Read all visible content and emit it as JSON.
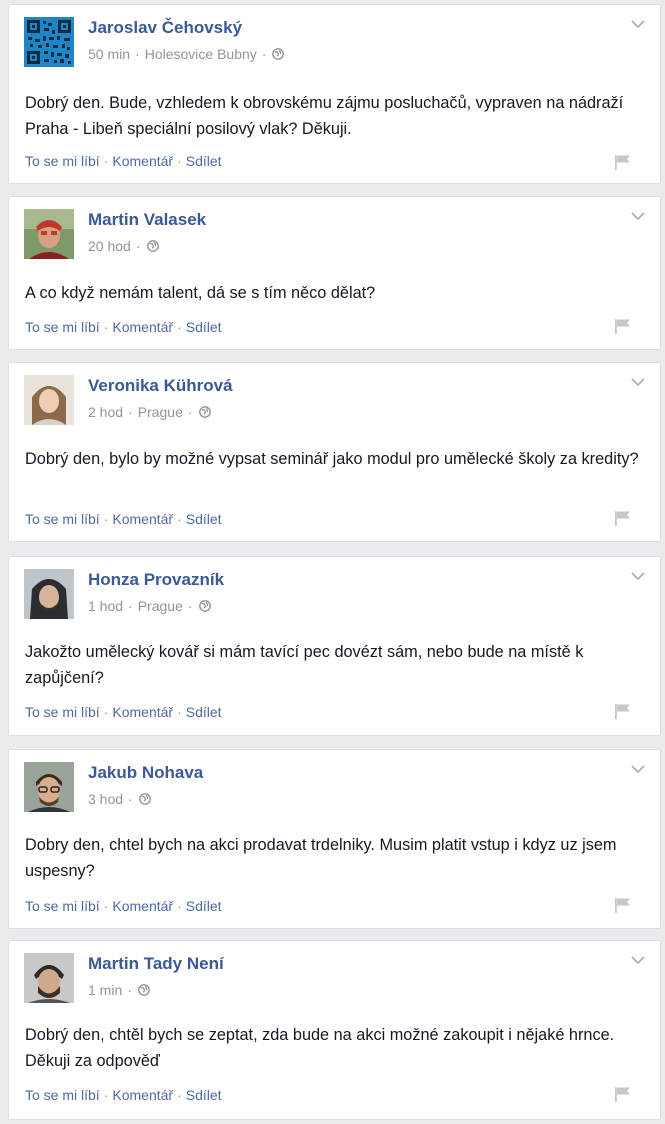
{
  "actions": {
    "like": "To se mi líbí",
    "comment": "Komentář",
    "share": "Sdílet",
    "separator": "·"
  },
  "posts": [
    {
      "author": "Jaroslav Čehovský",
      "time": "50 min",
      "location": "Holesovice Bubny",
      "audience_icon": "globe-icon",
      "text": "Dobrý den. Bude, vzhledem k obrovskému zájmu posluchačů, vypraven na nádraží Praha - Libeň speciální posilový vlak? Děkuji.",
      "avatar": "qr-code"
    },
    {
      "author": "Martin Valasek",
      "time": "20 hod",
      "location": "",
      "audience_icon": "globe-icon",
      "text": "A co když nemám talent, dá se s tím něco dělat?",
      "avatar": "photo"
    },
    {
      "author": "Veronika Kührová",
      "time": "2 hod",
      "location": "Prague",
      "audience_icon": "globe-icon",
      "text": "Dobrý den, bylo by možné vypsat seminář jako modul pro umělecké školy za kredity?",
      "avatar": "photo"
    },
    {
      "author": "Honza Provazník",
      "time": "1 hod",
      "location": "Prague",
      "audience_icon": "globe-icon",
      "text": "Jakožto umělecký kovář si mám tavící pec dovézt sám, nebo bude na místě k zapůjčení?",
      "avatar": "photo"
    },
    {
      "author": "Jakub Nohava",
      "time": "3 hod",
      "location": "",
      "audience_icon": "globe-icon",
      "text": "Dobry den, chtel bych na akci prodavat trdelniky. Musim platit vstup i kdyz uz jsem uspesny?",
      "avatar": "photo"
    },
    {
      "author": "Martin Tady Není",
      "time": "1 min",
      "location": "",
      "audience_icon": "globe-icon",
      "text": "Dobrý den, chtěl bych se zeptat, zda bude na akci možné zakoupit i nějaké hrnce. Děkuji za odpověď",
      "avatar": "photo"
    }
  ],
  "colors": {
    "link": "#3b5998",
    "action": "#4e69a2",
    "meta": "#90949c",
    "background": "#e9ebee"
  }
}
